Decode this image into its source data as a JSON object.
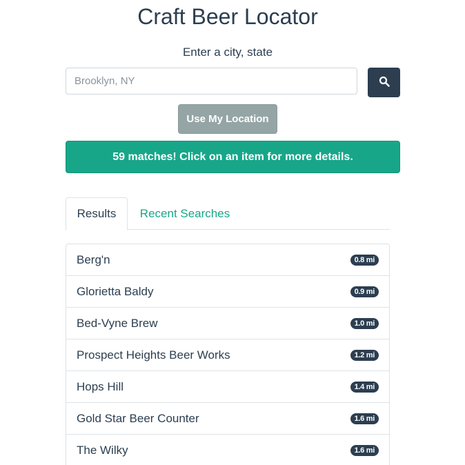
{
  "header": {
    "title": "Craft Beer Locator",
    "subtitle": "Enter a city, state"
  },
  "search": {
    "placeholder": "Brooklyn, NY",
    "value": "",
    "button_icon": "search-icon"
  },
  "location_button": {
    "label": "Use My Location"
  },
  "alert": {
    "message": "59 matches! Click on an item for more details."
  },
  "tabs": [
    {
      "label": "Results",
      "active": true
    },
    {
      "label": "Recent Searches",
      "active": false
    }
  ],
  "results": [
    {
      "name": "Berg'n",
      "distance": "0.8 mi"
    },
    {
      "name": "Glorietta Baldy",
      "distance": "0.9 mi"
    },
    {
      "name": "Bed-Vyne Brew",
      "distance": "1.0 mi"
    },
    {
      "name": "Prospect Heights Beer Works",
      "distance": "1.2 mi"
    },
    {
      "name": "Hops Hill",
      "distance": "1.4 mi"
    },
    {
      "name": "Gold Star Beer Counter",
      "distance": "1.6 mi"
    },
    {
      "name": "The Wilky",
      "distance": "1.6 mi"
    }
  ],
  "colors": {
    "primary": "#2c3e50",
    "success": "#18a689",
    "secondary": "#95a5a6"
  }
}
